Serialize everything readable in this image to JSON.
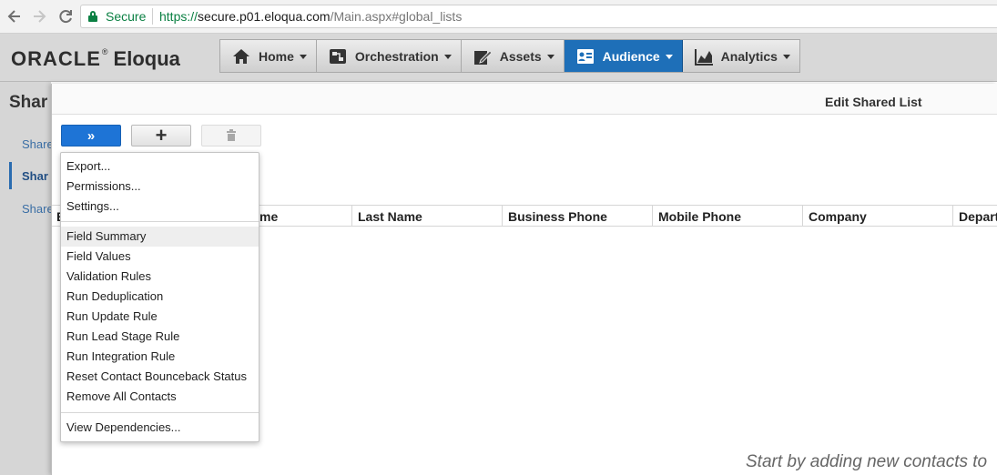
{
  "browser": {
    "secure_label": "Secure",
    "url_scheme": "https://",
    "url_host": "secure.p01.eloqua.com",
    "url_path": "/Main.aspx#global_lists"
  },
  "app": {
    "logo_oracle": "ORACLE",
    "logo_tm": "®",
    "logo_eloqua": "Eloqua",
    "nav": [
      {
        "label": "Home",
        "icon": "home-icon"
      },
      {
        "label": "Orchestration",
        "icon": "orchestration-icon"
      },
      {
        "label": "Assets",
        "icon": "assets-icon"
      },
      {
        "label": "Audience",
        "icon": "audience-icon",
        "active": true
      },
      {
        "label": "Analytics",
        "icon": "analytics-icon"
      }
    ],
    "accent_color": "#1e6fb8"
  },
  "left_panel": {
    "title": "Shar",
    "items": [
      "Share",
      "Shar",
      "Share"
    ]
  },
  "dialog": {
    "title": "Edit Shared List",
    "toolbar": {
      "expand_label": "»",
      "add_label": "+"
    },
    "grid": {
      "columns": [
        "E",
        "me",
        "Last Name",
        "Business Phone",
        "Mobile Phone",
        "Company",
        "Depart"
      ]
    },
    "empty_message": "Start by adding new contacts to"
  },
  "menu": {
    "group1": [
      "Export...",
      "Permissions...",
      "Settings..."
    ],
    "group2": [
      "Field Summary",
      "Field Values",
      "Validation Rules",
      "Run Deduplication",
      "Run Update Rule",
      "Run Lead Stage Rule",
      "Run Integration Rule",
      "Reset Contact Bounceback Status",
      "Remove All Contacts"
    ],
    "group3": [
      "View Dependencies..."
    ],
    "hovered": "Field Summary"
  }
}
